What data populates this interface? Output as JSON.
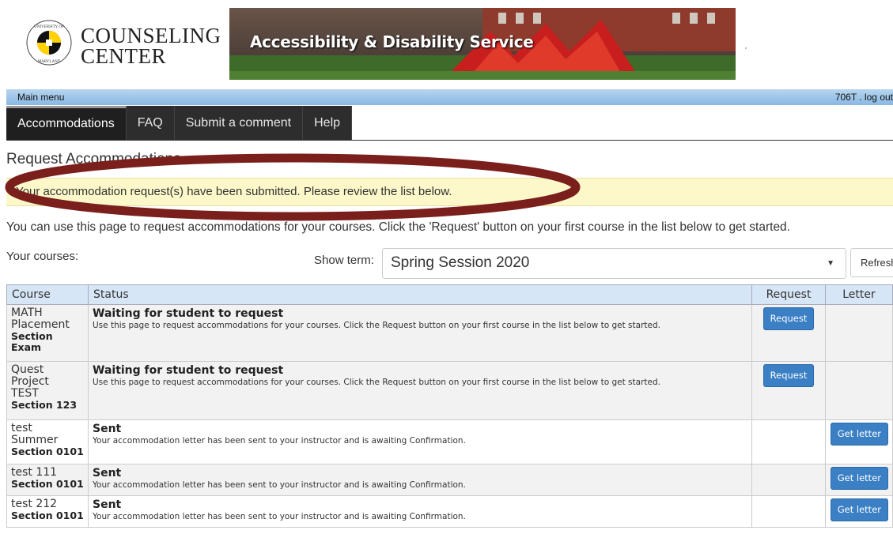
{
  "header": {
    "logo_line1": "COUNSELING",
    "logo_line2": "CENTER",
    "seal_text_top": "UNIVERSITY OF",
    "seal_text_bottom": "MARYLAND",
    "banner_title": "Accessibility & Disability Service"
  },
  "menu_bar": {
    "main_menu": "Main menu",
    "user": "706T . log out"
  },
  "tabs": [
    {
      "label": "Accommodations",
      "active": true
    },
    {
      "label": "FAQ"
    },
    {
      "label": "Submit a comment"
    },
    {
      "label": "Help"
    }
  ],
  "page": {
    "title": "Request Accommodations",
    "alert": "Your accommodation request(s) have been submitted. Please review the list below.",
    "intro": "You can use this page to request accommodations for your courses. Click the 'Request' button on your first course in the list below to get started.",
    "courses_label": "Your courses:",
    "term_label": "Show term:",
    "term_value": "Spring Session 2020",
    "refresh": "Refresh"
  },
  "table": {
    "headers": {
      "course": "Course",
      "status": "Status",
      "request": "Request",
      "letter": "Letter"
    },
    "rows": [
      {
        "course_lines": [
          "MATH",
          "Placement"
        ],
        "section": "Section Exam",
        "status": "Waiting for student to request",
        "desc": "Use this page to request accommodations for your courses. Click the Request button on your first course in the list below to get started.",
        "request_btn": "Request",
        "letter_btn": ""
      },
      {
        "course_lines": [
          "Quest",
          "Project",
          "TEST"
        ],
        "section": "Section 123",
        "status": "Waiting for student to request",
        "desc": "Use this page to request accommodations for your courses. Click the Request button on your first course in the list below to get started.",
        "request_btn": "Request",
        "letter_btn": ""
      },
      {
        "course_lines": [
          "test",
          "Summer"
        ],
        "section": "Section 0101",
        "status": "Sent",
        "desc": "Your accommodation letter has been sent to your instructor and is awaiting Confirmation.",
        "request_btn": "",
        "letter_btn": "Get letter"
      },
      {
        "course_lines": [
          "test 111"
        ],
        "section": "Section 0101",
        "status": "Sent",
        "desc": "Your accommodation letter has been sent to your instructor and is awaiting Confirmation.",
        "request_btn": "",
        "letter_btn": "Get letter"
      },
      {
        "course_lines": [
          "test 212"
        ],
        "section": "Section 0101",
        "status": "Sent",
        "desc": "Your accommodation letter has been sent to your instructor and is awaiting Confirmation.",
        "request_btn": "",
        "letter_btn": "Get letter"
      }
    ]
  },
  "colors": {
    "tab_bar": "#2d2d2d",
    "alert_bg": "#fdf8c9",
    "button": "#3b7fc4",
    "annotation_ellipse": "#7a1f1c"
  },
  "icons": {
    "seal": "umd-seal-icon",
    "dropdown": "caret-down-icon"
  }
}
